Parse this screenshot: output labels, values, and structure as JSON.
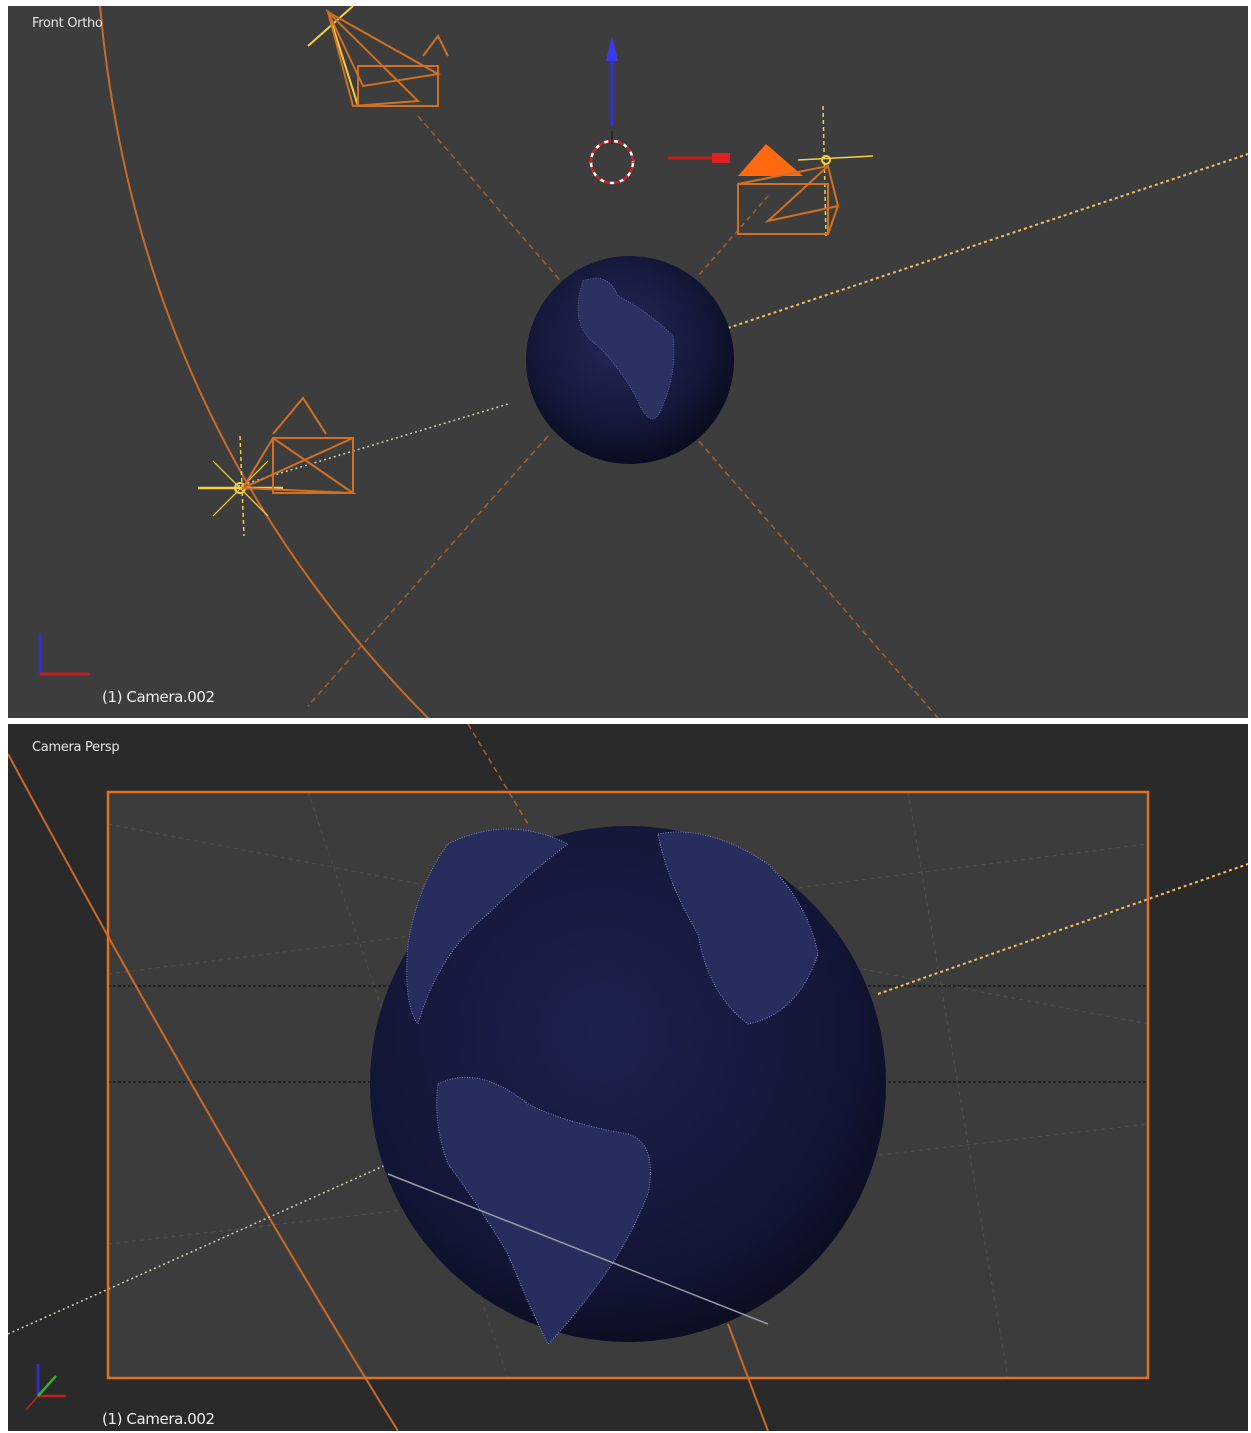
{
  "top_view": {
    "label": "Front Ortho",
    "active_object": "(1) Camera.002"
  },
  "bottom_view": {
    "label": "Camera Persp",
    "active_object": "(1) Camera.002"
  },
  "colors": {
    "viewport_bg": "#3d3d3d",
    "camera_view_bg": "#2a2a2a",
    "passepartout_fill": "#3c3c3c",
    "selection_orange": "#e07020",
    "active_yellow": "#f5d040",
    "axis_x": "#d02020",
    "axis_z": "#3030e0",
    "axis_y": "#30c030",
    "earth_night": "#10122e"
  },
  "icons": [
    "camera-icon",
    "lamp-icon",
    "3d-cursor-icon",
    "transform-gizmo-icon",
    "axis-orientation-icon"
  ]
}
